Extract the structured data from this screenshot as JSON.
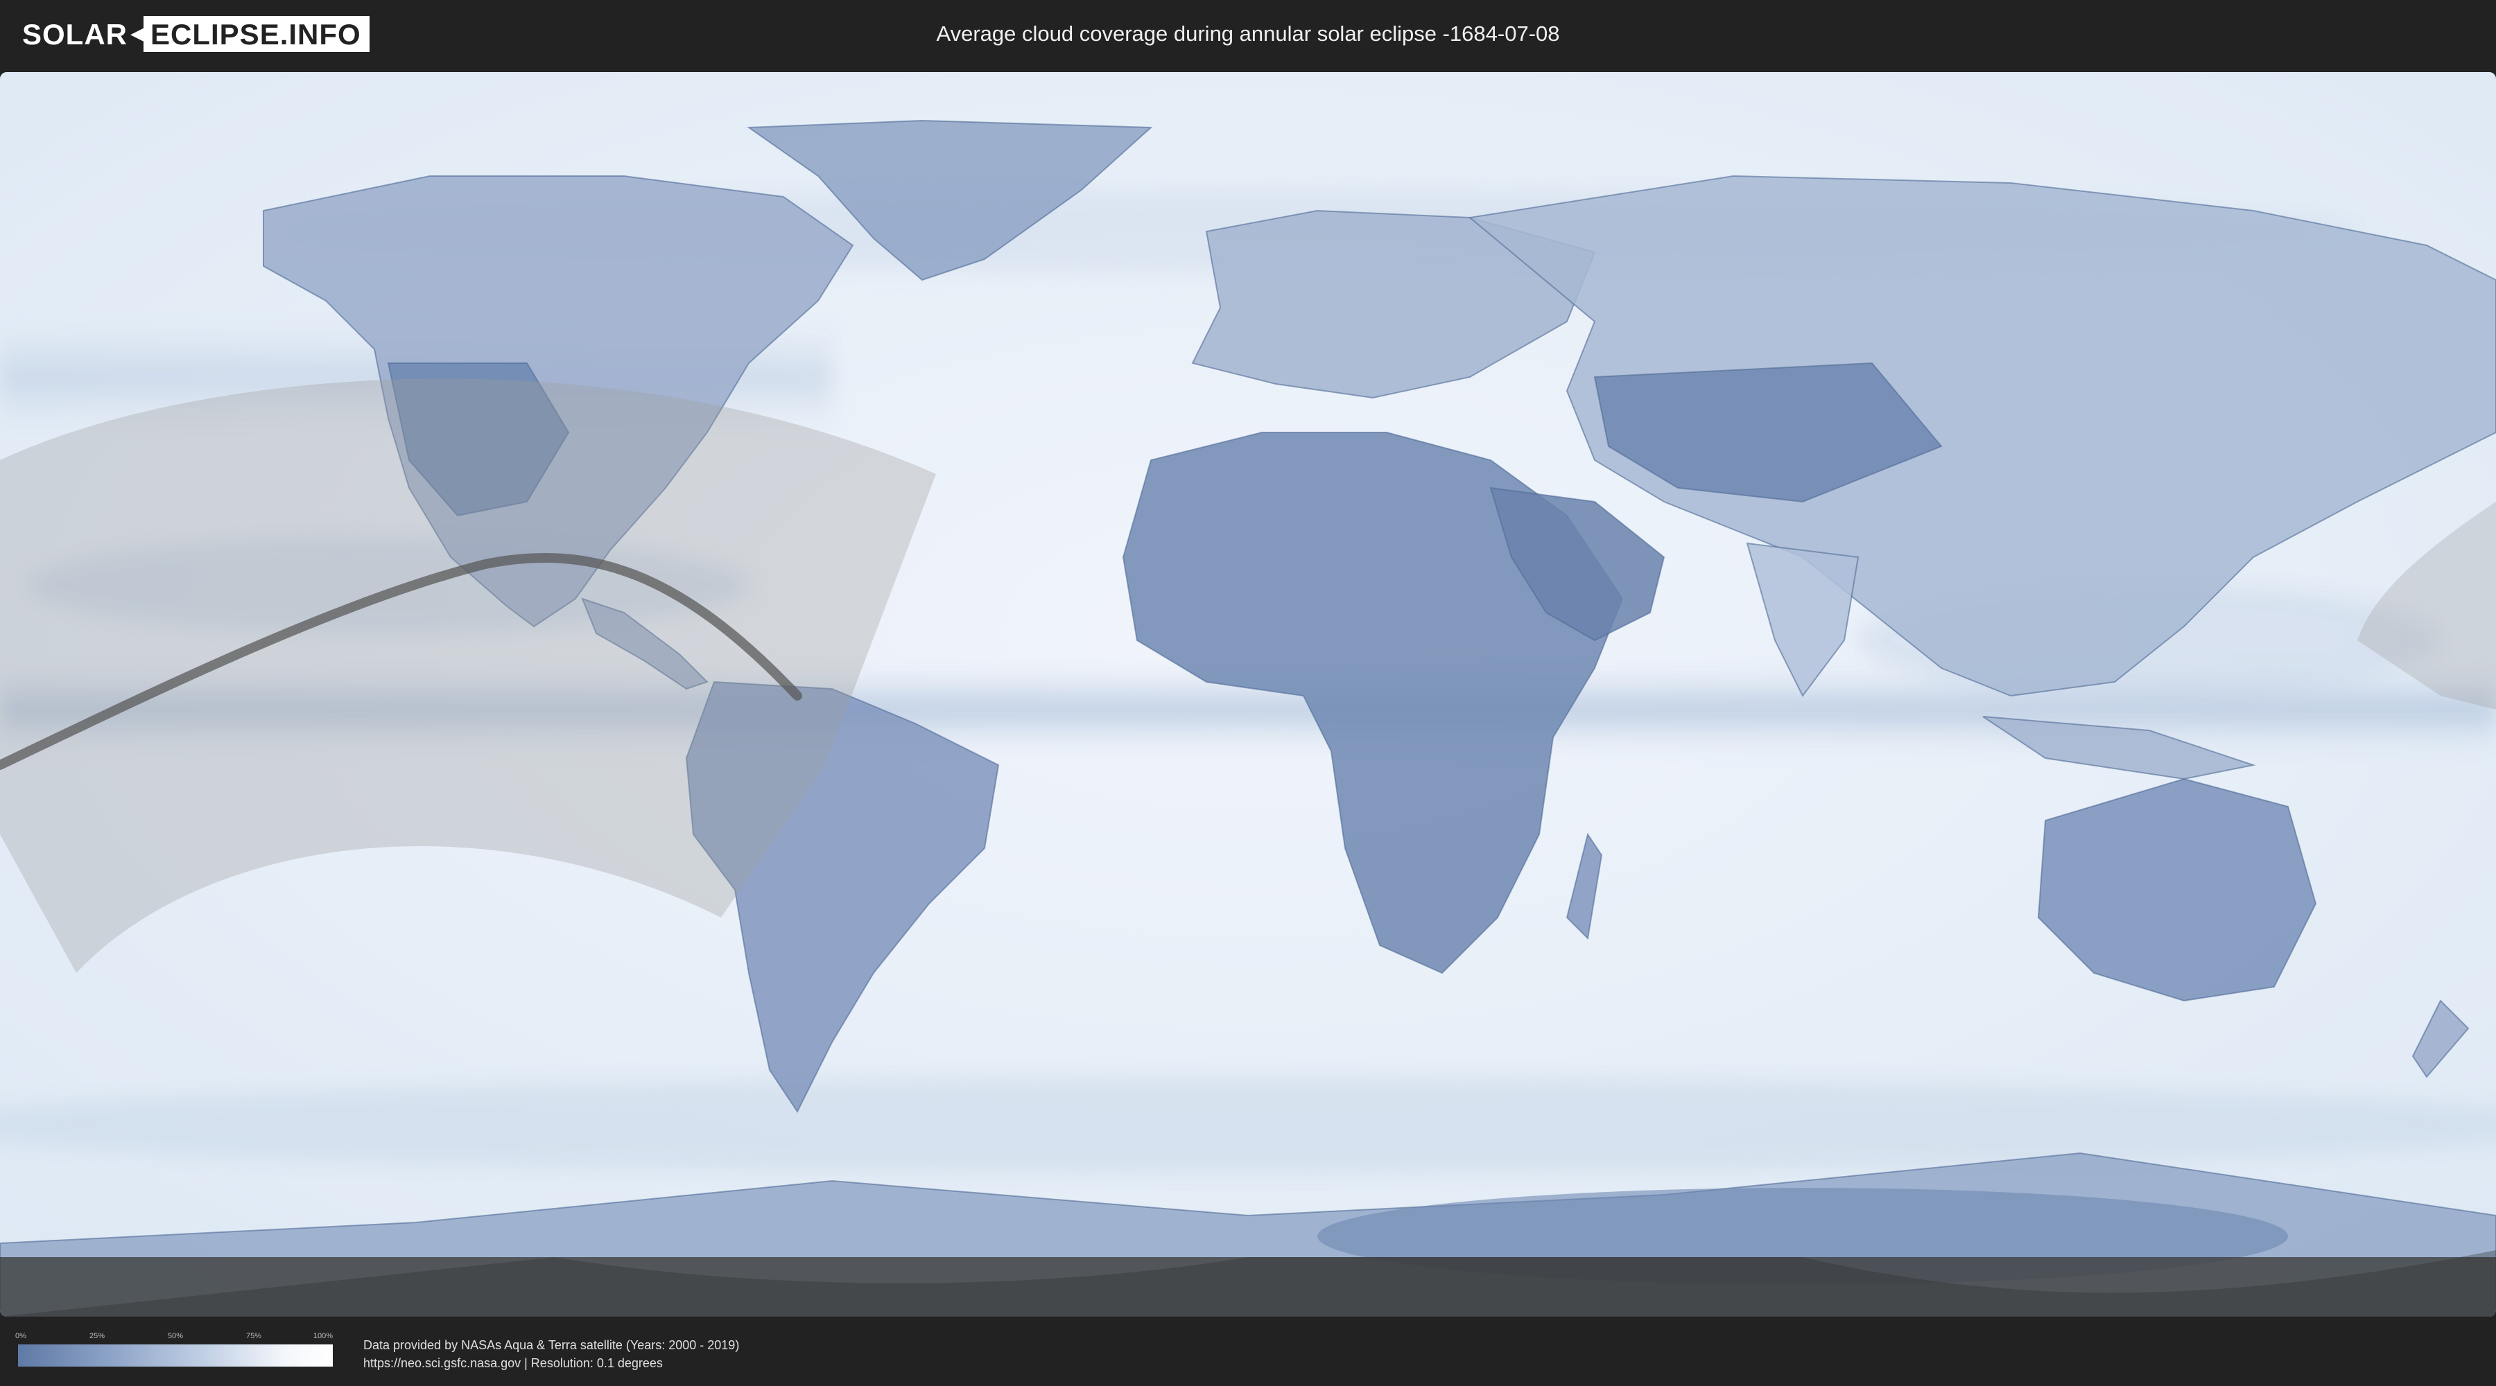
{
  "header": {
    "logo_left": "SOLAR",
    "logo_right": "ECLIPSE.INFO",
    "title": "Average cloud coverage during annular solar eclipse -1684-07-08"
  },
  "map": {
    "icon": "world-cloud-coverage-map",
    "colors": {
      "ocean_cloud": "#e9f0f8",
      "land_clear": "#6f88b2",
      "eclipse_zone": "#9a9a9a",
      "eclipse_path": "#5a5a5a"
    }
  },
  "legend": {
    "ticks": [
      "0%",
      "25%",
      "50%",
      "75%",
      "100%"
    ],
    "colors": {
      "low": "#5f7aa6",
      "high": "#ffffff"
    }
  },
  "credits": {
    "line1": "Data provided by NASAs Aqua & Terra satellite (Years: 2000 - 2019)",
    "line2": "https://neo.sci.gsfc.nasa.gov | Resolution: 0.1 degrees"
  }
}
